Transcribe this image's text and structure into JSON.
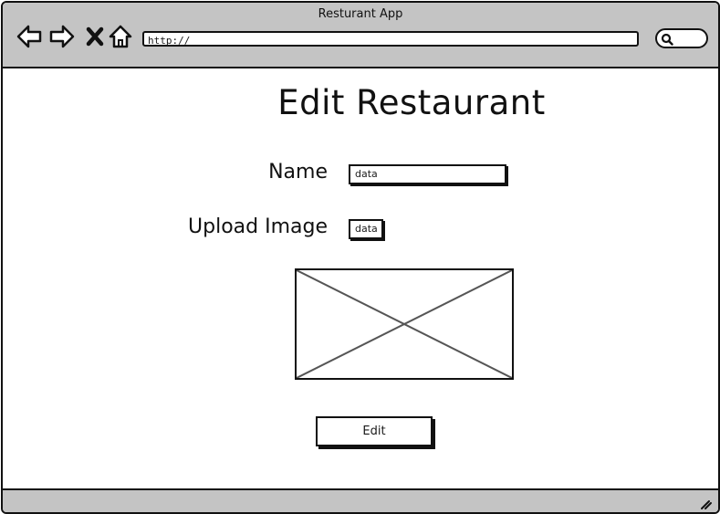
{
  "window": {
    "title": "Resturant App"
  },
  "browser": {
    "url": "http://"
  },
  "page": {
    "title": "Edit Restaurant",
    "name_label": "Name",
    "name_value": "data",
    "upload_label": "Upload Image",
    "upload_value": "data",
    "submit_label": "Edit"
  },
  "icons": {
    "back": "back-arrow-icon",
    "forward": "forward-arrow-icon",
    "stop": "close-icon",
    "home": "home-icon",
    "search": "search-icon",
    "image": "image-placeholder-icon",
    "resize": "resize-grip-icon"
  },
  "colors": {
    "chrome": "#c4c4c4",
    "stroke": "#111111",
    "background": "#ffffff"
  }
}
